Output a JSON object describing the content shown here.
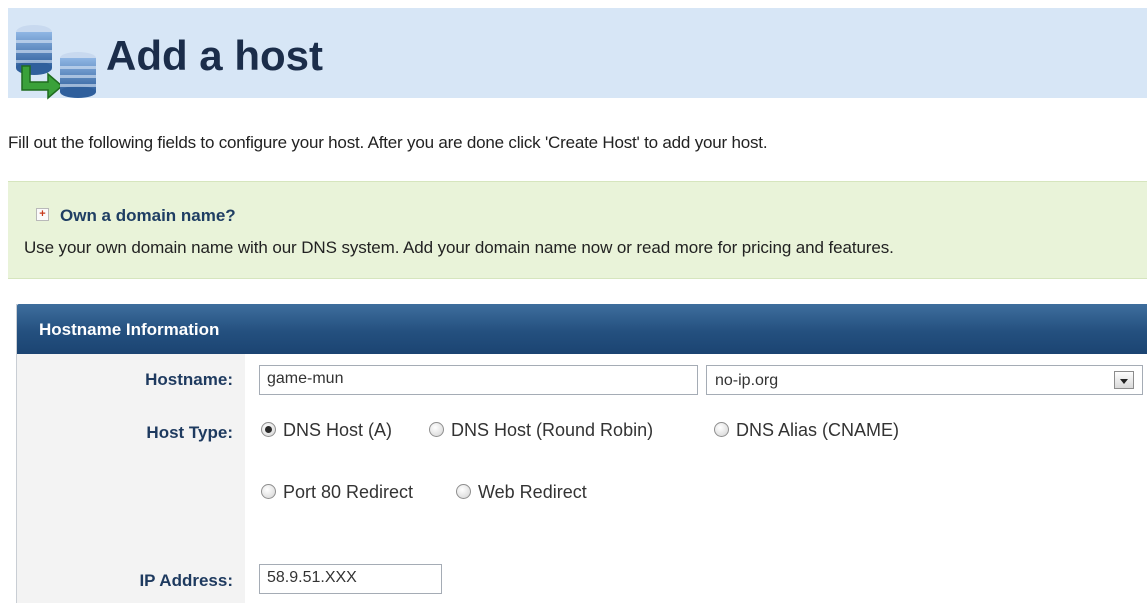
{
  "page": {
    "title": "Add a host",
    "icon": "server-add-icon",
    "intro": "Fill out the following fields to configure your host. After you are done click 'Create Host' to add your host."
  },
  "promo": {
    "title": "Own a domain name?",
    "text": "Use your own domain name with our DNS system. Add your domain name now or read more for pricing and features.",
    "icon": "expand-plus-icon"
  },
  "panel": {
    "title": "Hostname Information"
  },
  "form": {
    "hostname_label": "Hostname:",
    "hostname_value": "game-mun",
    "domain_value": "no-ip.org",
    "host_type_label": "Host Type:",
    "host_types": [
      {
        "label": "DNS Host (A)",
        "checked": true
      },
      {
        "label": "DNS Host (Round Robin)",
        "checked": false
      },
      {
        "label": "DNS Alias (CNAME)",
        "checked": false
      },
      {
        "label": "Port 80 Redirect",
        "checked": false
      },
      {
        "label": "Web Redirect",
        "checked": false
      }
    ],
    "ip_label": "IP Address:",
    "ip_value": "58.9.51.XXX"
  },
  "colors": {
    "header_bg": "#d7e6f6",
    "title_color": "#1b2d4a",
    "promo_bg": "#e9f3d9",
    "panel_header": "#24507f",
    "label_color": "#1e3a5f"
  }
}
